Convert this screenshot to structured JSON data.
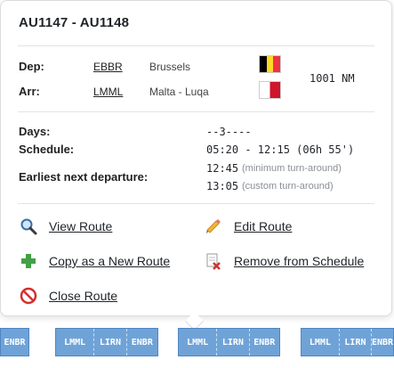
{
  "popup": {
    "title": "AU1147 - AU1148",
    "dep": {
      "label": "Dep:",
      "code": "EBBR",
      "city": "Brussels"
    },
    "arr": {
      "label": "Arr:",
      "code": "LMML",
      "city": "Malta - Luqa"
    },
    "distance": "1001 NM",
    "days": {
      "label": "Days:",
      "value": "--3----"
    },
    "schedule": {
      "label": "Schedule:",
      "value": "05:20 - 12:15 (06h 55')"
    },
    "earliest": {
      "label": "Earliest next departure:",
      "min_time": "12:45",
      "min_note": "(minimum turn-around)",
      "custom_time": "13:05",
      "custom_note": "(custom turn-around)"
    },
    "actions": {
      "view": "View Route",
      "edit": "Edit Route",
      "copy": "Copy as a New Route",
      "remove": "Remove from Schedule",
      "close": "Close Route"
    },
    "colors": {
      "flag_be": [
        "#000000",
        "#fdda24",
        "#ef3340"
      ],
      "flag_mt": [
        "#ffffff",
        "#cf142b"
      ]
    }
  },
  "timeline": {
    "strips": [
      {
        "cells": [
          "ENBR"
        ]
      },
      {
        "cells": [
          "LMML",
          "LIRN",
          "ENBR"
        ]
      },
      {
        "cells": [
          "LMML",
          "LIRN",
          "ENBR"
        ]
      },
      {
        "cells": [
          "LMML",
          "LIRN",
          "ENBR"
        ]
      }
    ],
    "color": "#6fa3d8"
  }
}
